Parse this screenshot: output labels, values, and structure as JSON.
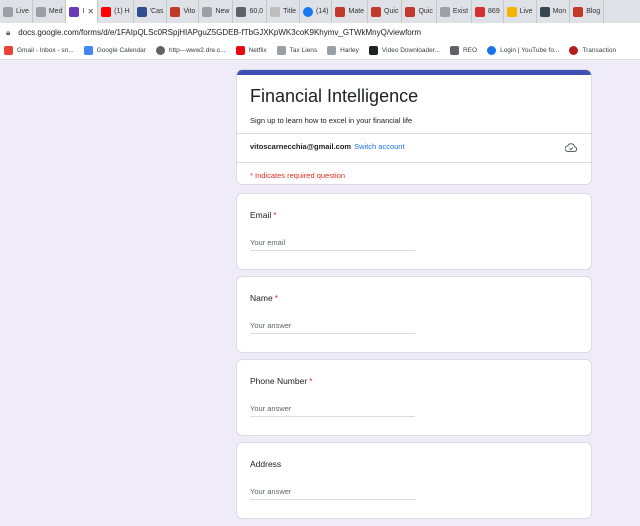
{
  "browser": {
    "tabs": [
      {
        "label": "Live",
        "color": "#9aa0a6",
        "active": false
      },
      {
        "label": "Med",
        "color": "#9aa0a6",
        "active": false
      },
      {
        "label": "I",
        "color": "#673ab7",
        "active": true
      },
      {
        "label": "(1) H",
        "color": "#ff0000",
        "active": false
      },
      {
        "label": "'Cas",
        "color": "#2f4f8f",
        "active": false
      },
      {
        "label": "Vito",
        "color": "#c0392b",
        "active": false
      },
      {
        "label": "New",
        "color": "#9aa0a6",
        "active": false
      },
      {
        "label": "60,0",
        "color": "#5f6368",
        "active": false
      },
      {
        "label": "Title",
        "color": "#bdbdbd",
        "active": false
      },
      {
        "label": "(14)",
        "color": "#1877f2",
        "active": false
      },
      {
        "label": "Mate",
        "color": "#c0392b",
        "active": false
      },
      {
        "label": "Quic",
        "color": "#c0392b",
        "active": false
      },
      {
        "label": "Quic",
        "color": "#c0392b",
        "active": false
      },
      {
        "label": "Exist",
        "color": "#9aa0a6",
        "active": false
      },
      {
        "label": "869",
        "color": "#d32f2f",
        "active": false
      },
      {
        "label": "Live",
        "color": "#f4b400",
        "active": false
      },
      {
        "label": "Mon",
        "color": "#37474f",
        "active": false
      },
      {
        "label": "Blog",
        "color": "#c0392b",
        "active": false
      }
    ],
    "url": "docs.google.com/forms/d/e/1FAIpQLSc0RSpjHIAPguZ5GDEB-fTbGJXKpWK3coK9Khymv_GTWkMnyQ/viewform",
    "bookmarks": [
      {
        "label": "Gmail - Inbox - sn...",
        "color": "#ea4335"
      },
      {
        "label": "Google Calendar",
        "color": "#4285f4"
      },
      {
        "label": "http---www2.dre.c...",
        "color": "#5f6368"
      },
      {
        "label": "Netflix",
        "color": "#e50914"
      },
      {
        "label": "Tax Liens",
        "color": "#9aa0a6"
      },
      {
        "label": "Harley",
        "color": "#9aa0a6"
      },
      {
        "label": "Video Downloader...",
        "color": "#202124"
      },
      {
        "label": "REO",
        "color": "#5f6368"
      },
      {
        "label": "Login | YouTube fo...",
        "color": "#1a73e8"
      },
      {
        "label": "Transaction",
        "color": "#b71c1c"
      }
    ]
  },
  "form": {
    "accent_color": "#3f51b5",
    "title": "Financial Intelligence",
    "description": "Sign up to learn how to excel in your financial life",
    "account_email": "vitoscarnecchia@gmail.com",
    "switch_account": "Switch account",
    "required_note": "* Indicates required question",
    "questions": [
      {
        "label": "Email",
        "required": "*",
        "placeholder": "Your email"
      },
      {
        "label": "Name",
        "required": "*",
        "placeholder": "Your answer"
      },
      {
        "label": "Phone Number",
        "required": "*",
        "placeholder": "Your answer"
      },
      {
        "label": "Address",
        "required": "",
        "placeholder": "Your answer"
      }
    ]
  }
}
